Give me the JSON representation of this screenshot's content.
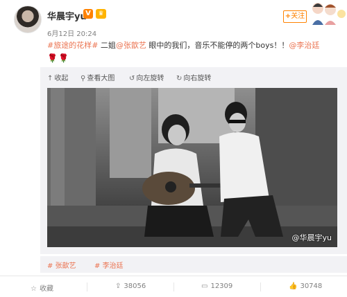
{
  "header": {
    "username": "华晨宇yu",
    "vip_badge": "V",
    "crown_badge": "♛",
    "post_time": "6月12日 20:24",
    "follow_label": "关注"
  },
  "post": {
    "topic_tag": "#旅途的花样#",
    "text_part1": " 二姐",
    "mention1": "@张歆艺",
    "text_part2": " 眼中的我们，音乐不能停的两个boys！！",
    "mention2": "@李治廷",
    "emoji": "🌹🌹"
  },
  "media_toolbar": {
    "collapse": "收起",
    "view_large": "查看大图",
    "rotate_left": "向左旋转",
    "rotate_right": "向右旋转"
  },
  "photo": {
    "watermark": "@华晨宇yu"
  },
  "topics": [
    {
      "label": "张歆艺"
    },
    {
      "label": "李治廷"
    }
  ],
  "actions": {
    "favorite": "收藏",
    "forward_count": "38056",
    "comment_count": "12309",
    "like_count": "30748"
  },
  "colors": {
    "accent": "#eb7350",
    "follow": "#ff8200",
    "muted": "#808080"
  }
}
